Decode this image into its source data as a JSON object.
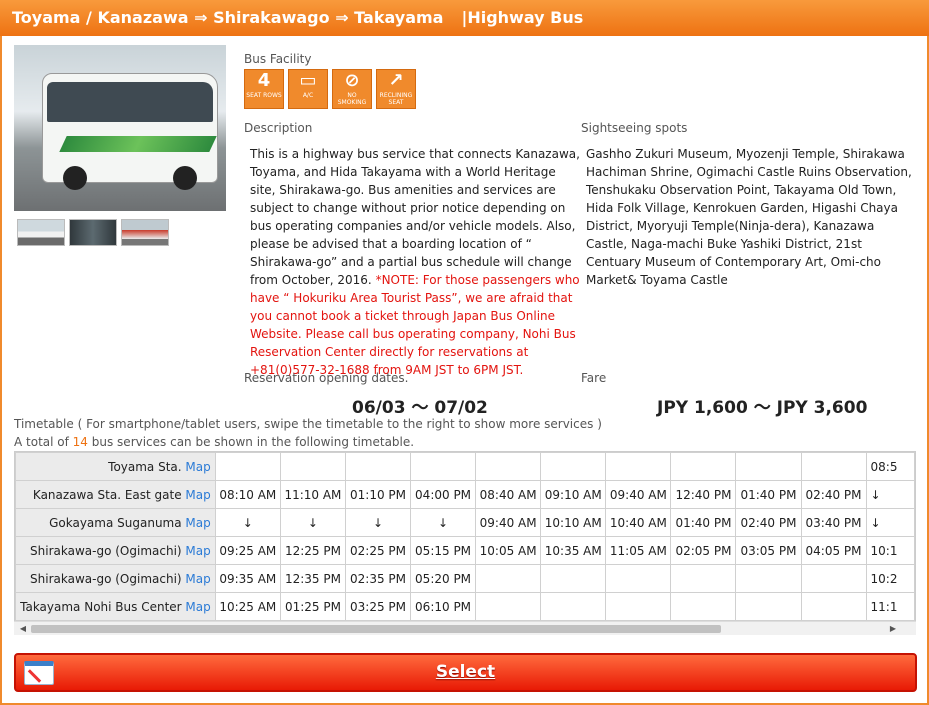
{
  "header": {
    "route": "Toyama / Kanazawa ⇒ Shirakawago ⇒ Takayama",
    "type": "|Highway Bus"
  },
  "facility": {
    "label": "Bus Facility",
    "items": [
      {
        "icon": "4-seat-rows-icon",
        "glyph": "4",
        "text": "SEAT ROWS"
      },
      {
        "icon": "ac-icon",
        "glyph": "▭",
        "text": "A/C"
      },
      {
        "icon": "no-smoking-icon",
        "glyph": "⊘",
        "text": "NO SMOKING"
      },
      {
        "icon": "reclining-seat-icon",
        "glyph": "↗",
        "text": "RECLINING SEAT"
      }
    ]
  },
  "description": {
    "label": "Description",
    "text": "This is a highway bus service that connects Kanazawa, Toyama, and Hida Takayama with a World Heritage site, Shirakawa-go. Bus amenities and services are subject to change without prior notice depending on bus operating companies and/or vehicle models. Also, please be advised that a boarding location of “ Shirakawa-go” and    a partial bus schedule will change from October, 2016. ",
    "note": "*NOTE: For those passengers who have “ Hokuriku Area Tourist Pass”, we are afraid that you cannot book a ticket through Japan Bus Online Website. Please call bus operating company, Nohi Bus Reservation Center directly for reservations at +81(0)577-32-1688 from 9AM JST to 6PM JST."
  },
  "sightseeing": {
    "label": "Sightseeing spots",
    "text": "Gashho Zukuri Museum, Myozenji Temple, Shirakawa Hachiman Shrine, Ogimachi Castle Ruins Observation, Tenshukaku Observation Point, Takayama Old Town, Hida Folk Village, Kenrokuen Garden, Higashi Chaya District, Myoryuji Temple(Ninja-dera), Kanazawa Castle, Naga-machi Buke Yashiki District, 21st Centuary Museum of Contemporary Art, Omi-cho Market& Toyama Castle"
  },
  "reservation": {
    "label": "Reservation opening dates.",
    "value": "06/03 〜 07/02"
  },
  "fare": {
    "label": "Fare",
    "value": "JPY 1,600 〜 JPY 3,600"
  },
  "timetable": {
    "note": "Timetable ( For smartphone/tablet users, swipe the timetable to the right to show more services )",
    "total_prefix": "A total of ",
    "total_count": "14",
    "total_suffix": " bus services can be shown in the following timetable.",
    "map_label": "Map",
    "rows": [
      {
        "stop": "Toyama Sta.",
        "times": [
          "",
          "",
          "",
          "",
          "",
          "",
          "",
          "",
          "",
          "",
          "08:5"
        ]
      },
      {
        "stop": "Kanazawa Sta. East gate",
        "times": [
          "08:10 AM",
          "11:10 AM",
          "01:10 PM",
          "04:00 PM",
          "08:40 AM",
          "09:10 AM",
          "09:40 AM",
          "12:40 PM",
          "01:40 PM",
          "02:40 PM",
          "↓"
        ]
      },
      {
        "stop": "Gokayama Suganuma",
        "times": [
          "↓",
          "↓",
          "↓",
          "↓",
          "09:40 AM",
          "10:10 AM",
          "10:40 AM",
          "01:40 PM",
          "02:40 PM",
          "03:40 PM",
          "↓"
        ]
      },
      {
        "stop": "Shirakawa-go (Ogimachi)",
        "times": [
          "09:25 AM",
          "12:25 PM",
          "02:25 PM",
          "05:15 PM",
          "10:05 AM",
          "10:35 AM",
          "11:05 AM",
          "02:05 PM",
          "03:05 PM",
          "04:05 PM",
          "10:1"
        ]
      },
      {
        "stop": "Shirakawa-go (Ogimachi)",
        "times": [
          "09:35 AM",
          "12:35 PM",
          "02:35 PM",
          "05:20 PM",
          "",
          "",
          "",
          "",
          "",
          "",
          "10:2"
        ]
      },
      {
        "stop": "Takayama Nohi Bus Center",
        "times": [
          "10:25 AM",
          "01:25 PM",
          "03:25 PM",
          "06:10 PM",
          "",
          "",
          "",
          "",
          "",
          "",
          "11:1"
        ]
      }
    ]
  },
  "select_button": "Select"
}
